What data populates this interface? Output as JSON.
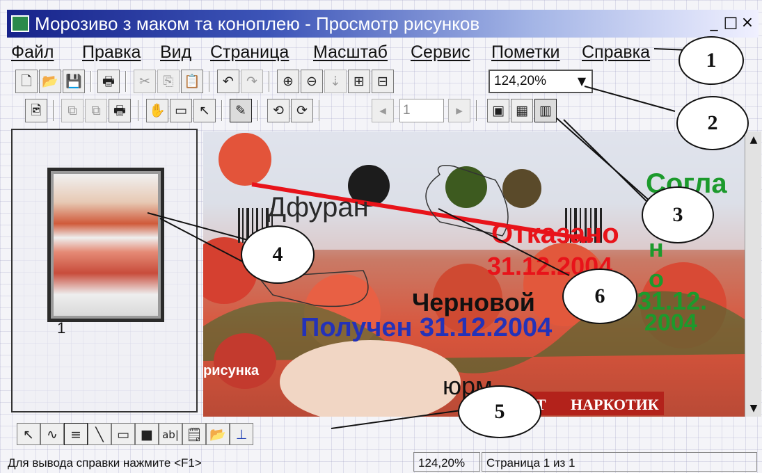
{
  "window": {
    "title": "Морозиво з маком та коноплею   - Просмотр рисунков",
    "minimize_glyph": "_",
    "maximize_glyph": "□",
    "close_glyph": "×"
  },
  "menu": {
    "items": [
      {
        "label": "Файл"
      },
      {
        "label": "Правка"
      },
      {
        "label": "Вид"
      },
      {
        "label": "Страница"
      },
      {
        "label": "Масштаб"
      },
      {
        "label": "Сервис"
      },
      {
        "label": "Пометки"
      },
      {
        "label": "Справка"
      }
    ]
  },
  "toolbar_main": {
    "buttons": [
      {
        "icon": "new-document-icon",
        "glyph": "🗋",
        "enabled": true
      },
      {
        "icon": "open-folder-icon",
        "glyph": "📂",
        "enabled": true
      },
      {
        "icon": "save-disk-icon",
        "glyph": "💾",
        "enabled": true
      },
      {
        "icon": "print-icon",
        "glyph": "🖶",
        "enabled": true
      },
      {
        "icon": "cut-icon",
        "glyph": "✂",
        "enabled": false
      },
      {
        "icon": "copy-icon",
        "glyph": "⎘",
        "enabled": false
      },
      {
        "icon": "paste-icon",
        "glyph": "📋",
        "enabled": true
      },
      {
        "icon": "undo-icon",
        "glyph": "↶",
        "enabled": true
      },
      {
        "icon": "redo-icon",
        "glyph": "↷",
        "enabled": false
      },
      {
        "icon": "zoom-in-icon",
        "glyph": "⊕",
        "enabled": true
      },
      {
        "icon": "zoom-out-icon",
        "glyph": "⊖",
        "enabled": true
      },
      {
        "icon": "fit-page-icon",
        "glyph": "⇣",
        "enabled": false
      },
      {
        "icon": "fit-window-icon",
        "glyph": "⊞",
        "enabled": true
      },
      {
        "icon": "fit-width-icon",
        "glyph": "⊟",
        "enabled": true
      }
    ],
    "zoom_value": "124,20%",
    "zoom_dropdown_glyph": "▼"
  },
  "toolbar_view": {
    "buttons": [
      {
        "icon": "open-image-icon",
        "glyph": "🖻",
        "enabled": true
      },
      {
        "icon": "pages-copy-icon",
        "glyph": "⧉",
        "enabled": false
      },
      {
        "icon": "pages-move-icon",
        "glyph": "⧉",
        "enabled": false
      },
      {
        "icon": "pages-print-icon",
        "glyph": "🖶",
        "enabled": true
      },
      {
        "icon": "hand-pan-icon",
        "glyph": "✋",
        "enabled": true
      },
      {
        "icon": "select-rectangle-icon",
        "glyph": "▭",
        "enabled": true
      },
      {
        "icon": "pointer-icon",
        "glyph": "↖",
        "enabled": true
      },
      {
        "icon": "edit-annotations-icon",
        "glyph": "✎",
        "enabled": true
      },
      {
        "icon": "rotate-left-icon",
        "glyph": "⟲",
        "enabled": true
      },
      {
        "icon": "rotate-right-icon",
        "glyph": "⟳",
        "enabled": true
      },
      {
        "icon": "previous-page-icon",
        "glyph": "◂",
        "enabled": false
      },
      {
        "icon": "next-page-icon",
        "glyph": "▸",
        "enabled": false
      },
      {
        "icon": "single-view-icon",
        "glyph": "▣",
        "enabled": true
      },
      {
        "icon": "grid-view-icon",
        "glyph": "▦",
        "enabled": true
      },
      {
        "icon": "thumbnails-view-icon",
        "glyph": "▥",
        "enabled": true
      }
    ],
    "page_number": "1"
  },
  "thumbnails": {
    "items": [
      {
        "caption": "1"
      }
    ]
  },
  "document_view": {
    "image_texts": {
      "agreed": "Согла",
      "agreed_col": "с\nн\nо",
      "date_green": "31.12.\n2004",
      "rejected": "Отказано",
      "rejected_date": "31.12.2004",
      "draft": "Черновой",
      "received": "Получен 31.12.2004",
      "dfuran": "Дфуран",
      "yurm": "юрм",
      "picture_label": "рисунка",
      "stamp_right": "НАРКОТИК",
      "stamp_left": "СТ"
    }
  },
  "scrollbar": {
    "up_glyph": "▲",
    "down_glyph": "▼"
  },
  "drawing_toolbar": {
    "buttons": [
      {
        "icon": "select-arrow-icon",
        "glyph": "↖"
      },
      {
        "icon": "freehand-icon",
        "glyph": "∿"
      },
      {
        "icon": "highlighter-icon",
        "glyph": "≡"
      },
      {
        "icon": "line-icon",
        "glyph": "╲"
      },
      {
        "icon": "hollow-rectangle-icon",
        "glyph": "▭"
      },
      {
        "icon": "filled-rectangle-icon",
        "glyph": "■"
      },
      {
        "icon": "text-annotation-icon",
        "glyph": "ab|"
      },
      {
        "icon": "sticky-note-icon",
        "glyph": "🗒"
      },
      {
        "icon": "attach-icon",
        "glyph": "📂"
      },
      {
        "icon": "stamp-icon",
        "glyph": "⊥"
      }
    ]
  },
  "status": {
    "hint": "Для вывода справки нажмите <F1>",
    "zoom": "124,20%",
    "page": "Страница 1 из 1"
  },
  "callouts": {
    "items": [
      "1",
      "2",
      "3",
      "4",
      "5",
      "6"
    ]
  }
}
